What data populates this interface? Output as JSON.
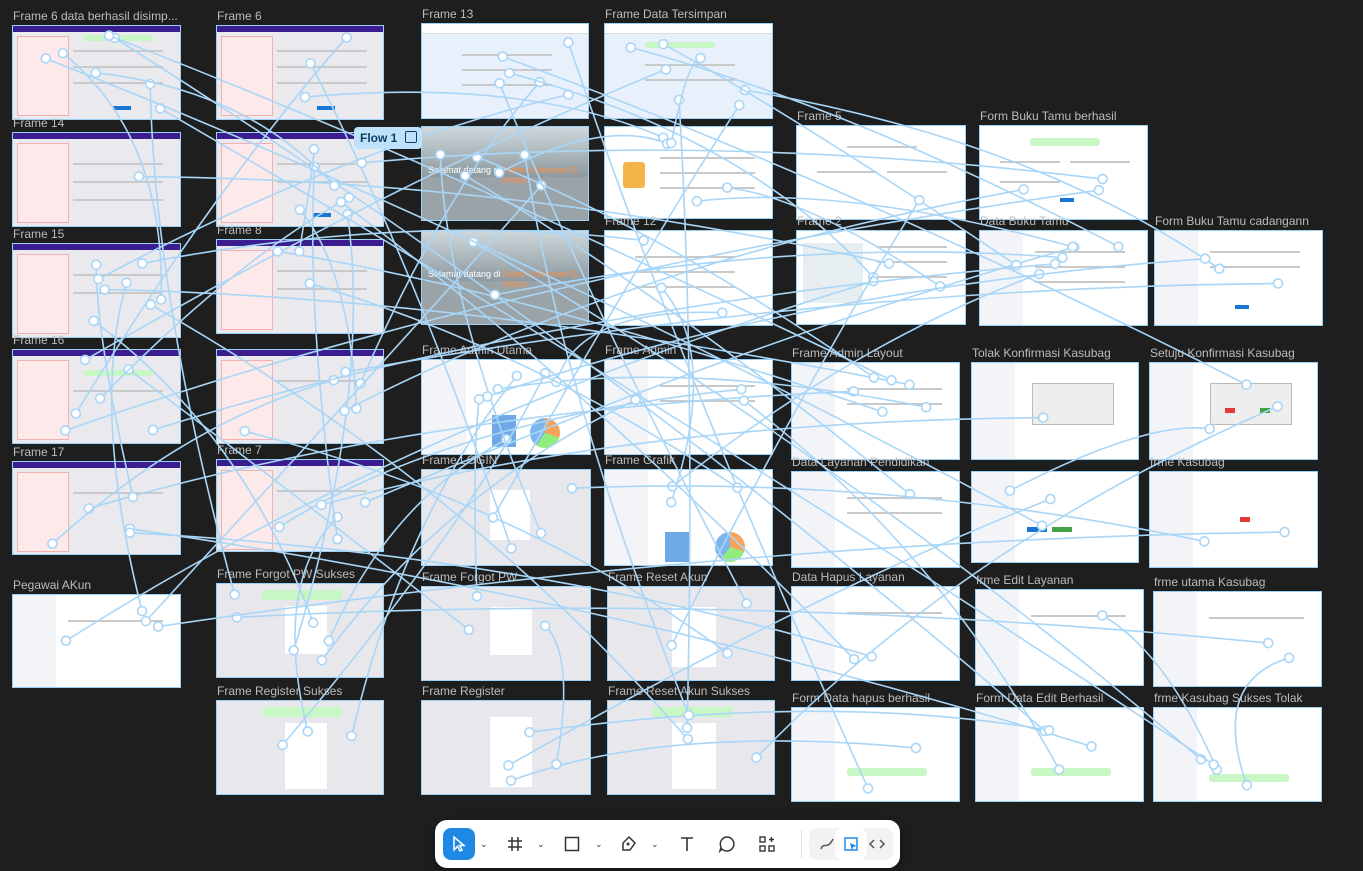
{
  "canvas": {
    "background": "#1e1e1e",
    "wire_color": "#a9d6f7",
    "selection_color": "#9bd0f5"
  },
  "flow_tag": {
    "label": "Flow 1"
  },
  "frames": {
    "f6ds": "Frame 6 data berhasil disimp...",
    "f6": "Frame 6",
    "f13": "Frame 13",
    "fdt": "Frame Data Tersimpan",
    "f14": "Frame 14",
    "f5": "Frame 5",
    "fbtb": "Form Buku Tamu berhasil",
    "f15": "Frame 15",
    "f8": "Frame 8",
    "f12": "Frame 12",
    "f2": "Frame 2",
    "dbt": "Data Buku Tamu",
    "fbtc": "Form Buku Tamu cadangann",
    "f16": "Frame 16",
    "faf": "Frame Admin Utama",
    "fadmin": "Frame Admin",
    "fal": "Frame Admin Layout",
    "tks": "Tolak Konfirmasi Kasubag",
    "sks": "Setuju Konfirmasi Kasubag",
    "f17": "Frame 17",
    "f7": "Frame 7",
    "flogin": "Frame LOGIN",
    "fgrafik": "Frame Grafik",
    "dlp": "Data Layanan Pendidikan",
    "fkasubag": "frme Kasubag",
    "pak": "Pegawai AKun",
    "ffps": "Frame Forgot PW Sukses",
    "ffp": "Frame Forgot PW",
    "fra": "Frame Reset Akun",
    "dhl": "Data Hapus Layanan",
    "fel": "frme Edit Layanan",
    "fuk": "frme utama Kasubag",
    "frs": "Frame Register Sukses",
    "freg": "Frame Register",
    "fras": "Frame Reset Akun Sukses",
    "fdhb": "Form Data hapus berhasil",
    "fdeb": "Form Data Edit Berhasil",
    "fkst": "frme Kasubag Sukses Tolak"
  },
  "mock": {
    "welcome": "Selamat datang di",
    "system": "Sistem Informasi E-Visitor",
    "app": "E-VISITOR BPMP",
    "toast_ok": "Data berhasil disimpan"
  },
  "toolbar": {
    "tools": [
      "move-tool",
      "frame-tool",
      "shape-tool",
      "pen-tool",
      "text-tool",
      "comment-tool",
      "actions-tool"
    ],
    "modes": [
      "draw-mode",
      "design-mode",
      "dev-mode"
    ],
    "active_color": "#1e88e5"
  }
}
